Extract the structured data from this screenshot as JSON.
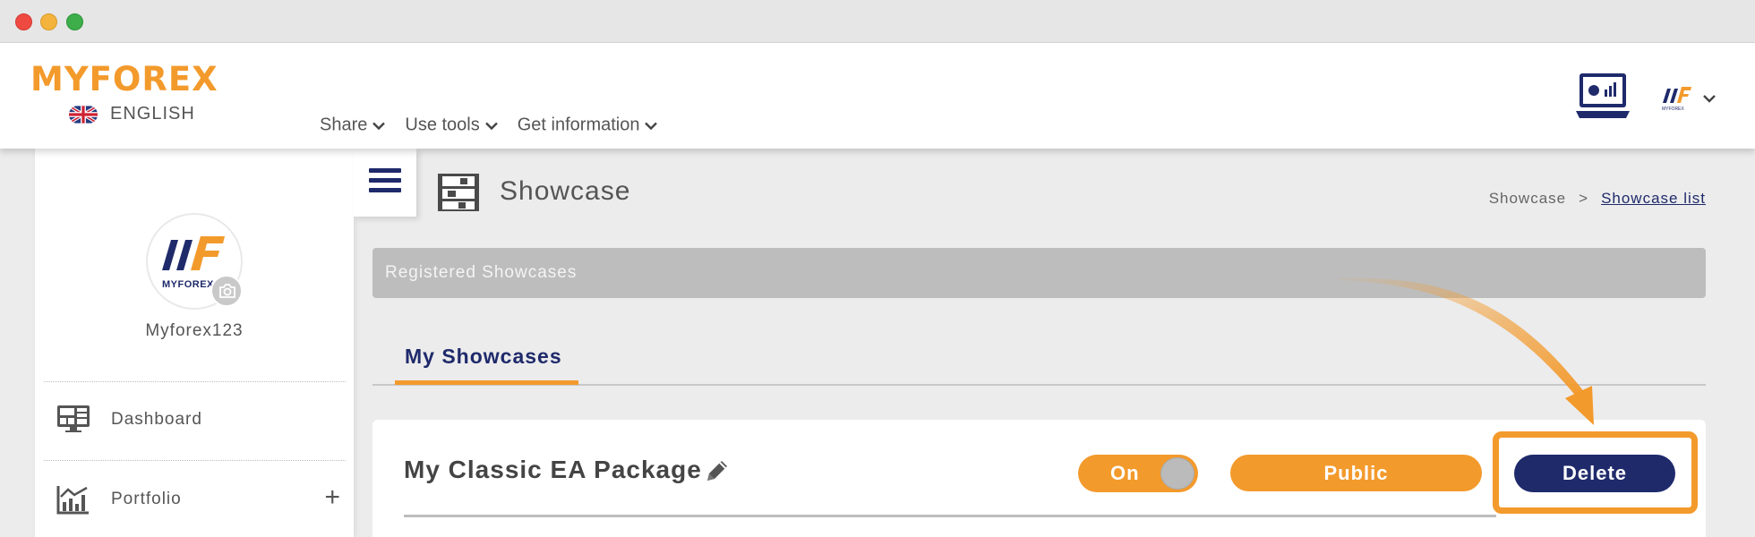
{
  "header": {
    "logo_text": "MYFOREX",
    "language": "ENGLISH",
    "nav": [
      {
        "label": "Share"
      },
      {
        "label": "Use tools"
      },
      {
        "label": "Get information"
      }
    ],
    "user_logo_text": "MYFOREX"
  },
  "sidebar": {
    "avatar_logo_text": "MYFOREX",
    "username": "Myforex123",
    "items": [
      {
        "label": "Dashboard"
      },
      {
        "label": "Portfolio",
        "expand": "+"
      }
    ]
  },
  "page": {
    "title": "Showcase",
    "breadcrumb": {
      "first": "Showcase",
      "separator": ">",
      "current": "Showcase list"
    },
    "section_bar": "Registered Showcases",
    "tab_active": "My Showcases"
  },
  "card": {
    "title": "My Classic EA Package",
    "toggle_label": "On",
    "toggle_state": "on",
    "public_label": "Public",
    "delete_label": "Delete"
  },
  "colors": {
    "brand_orange": "#f39a2c",
    "brand_navy": "#1f2a6b",
    "section_gray": "#bdbdbd"
  },
  "icons": [
    "hamburger-icon",
    "showcase-icon",
    "dashboard-icon",
    "portfolio-icon",
    "camera-icon",
    "pencil-icon",
    "monitor-chart-icon",
    "chevron-down-icon",
    "uk-flag-icon"
  ]
}
